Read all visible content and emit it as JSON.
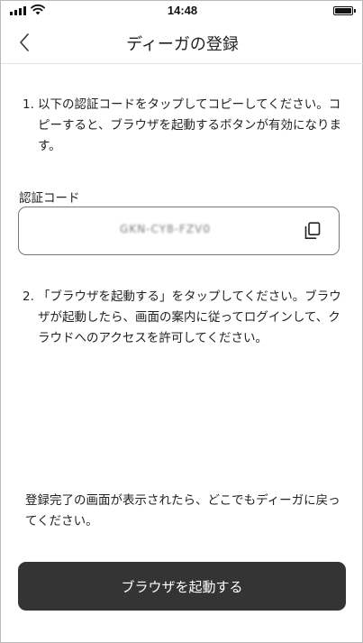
{
  "status_bar": {
    "time": "14:48"
  },
  "nav": {
    "title": "ディーガの登録"
  },
  "steps": [
    {
      "number": "1.",
      "text": "以下の認証コードをタップしてコピーしてください。コピーすると、ブラウザを起動するボタンが有効になります。"
    },
    {
      "number": "2.",
      "text": "「ブラウザを起動する」をタップしてください。ブラウザが起動したら、画面の案内に従ってログインして、クラウドへのアクセスを許可してください。"
    }
  ],
  "code": {
    "label": "認証コード",
    "value": "GKN-CY8-FZV0"
  },
  "done_text": "登録完了の画面が表示されたら、どこでもディーガに戻ってください。",
  "launch_button": {
    "label": "ブラウザを起動する"
  },
  "icons": {
    "back": "chevron-left-icon",
    "copy": "copy-icon",
    "signal": "signal-icon",
    "wifi": "wifi-icon",
    "battery": "battery-icon"
  },
  "colors": {
    "button_bg": "#343434",
    "button_text": "#ffffff",
    "border": "#777777"
  }
}
